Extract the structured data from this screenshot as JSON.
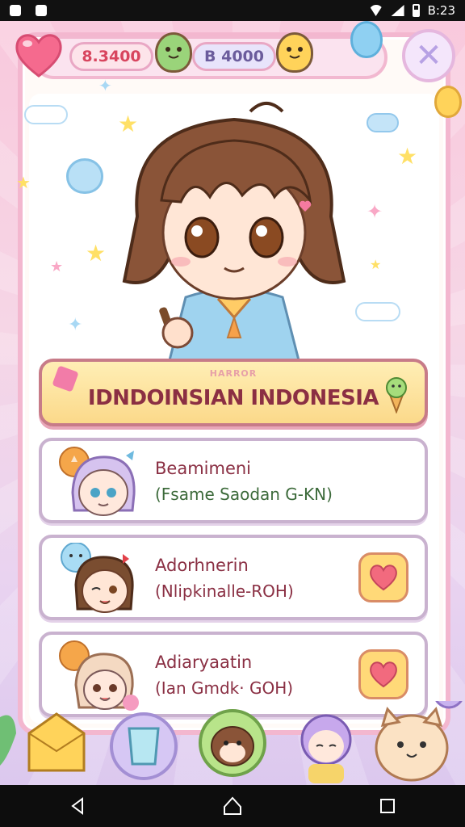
{
  "status_bar": {
    "time": "B:23"
  },
  "currency": {
    "coins": "8.3400",
    "gems": "B 4000"
  },
  "close_glyph": "✕",
  "banner": {
    "subtitle": "HARROR",
    "title": "IDNDOINSIAN INDONESIA"
  },
  "list": [
    {
      "title": "Beamimeni",
      "subtitle": "(Fsame Saodan G-KN)"
    },
    {
      "title": "Adorhnerin",
      "subtitle": "(Nlipkinalle-ROH)"
    },
    {
      "title": "Adiaryaatin",
      "subtitle": "(Ian Gmdk· GOH)"
    }
  ],
  "colors": {
    "accent_pink": "#f3b7cf",
    "banner_text": "#8b2f43",
    "banner_bg": "#fbd98a"
  },
  "icons": [
    "heart-icon",
    "mascot-icon",
    "close-icon",
    "star-icon",
    "cloud-icon",
    "balloon-icon",
    "ice-cream-icon",
    "back-icon",
    "home-icon",
    "recents-icon"
  ]
}
